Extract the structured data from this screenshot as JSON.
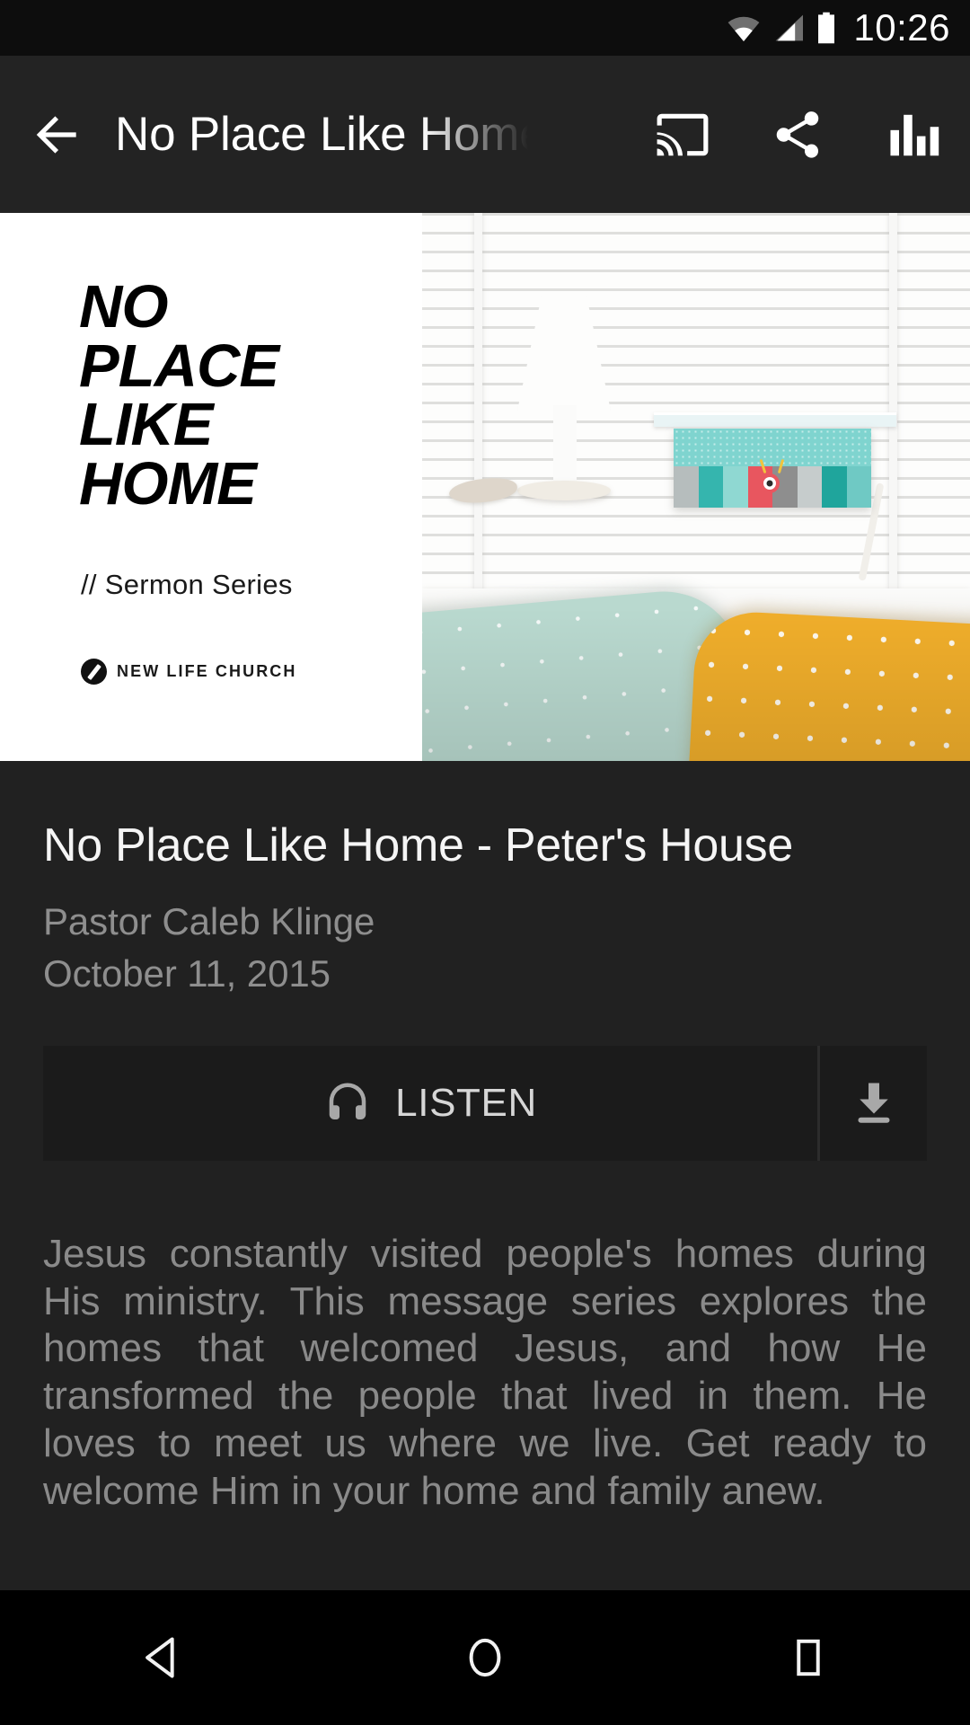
{
  "status_bar": {
    "time": "10:26",
    "icons": [
      "wifi-icon",
      "cellular-signal-icon",
      "battery-icon"
    ]
  },
  "app_bar": {
    "back_icon": "arrow-back-icon",
    "title": "No Place Like Home",
    "actions": [
      {
        "name": "cast-icon",
        "label": "Cast"
      },
      {
        "name": "share-icon",
        "label": "Share"
      },
      {
        "name": "equalizer-icon",
        "label": "Equalizer"
      }
    ]
  },
  "artwork": {
    "lines": [
      "NO",
      "PLACE",
      "LIKE",
      "HOME"
    ],
    "subtitle": "// Sermon Series",
    "church": "NEW LIFE CHURCH",
    "photo_alt": "Bedroom window with lamp, teal storage box and pillows",
    "colors": {
      "lid": "#7fd4cf",
      "pillow_mint": "#b9d9cf",
      "pillow_yellow": "#f0ae2b",
      "monster_red": "#e8565f"
    },
    "box_stripes": [
      "#b6bdbd",
      "#35b5ae",
      "#8fd8d2",
      "#e8565f",
      "#8e8e8e",
      "#c6cccc",
      "#1fa59c",
      "#6fc9c4"
    ]
  },
  "details": {
    "title": "No Place Like Home - Peter's House",
    "speaker": "Pastor Caleb Klinge",
    "date": "October 11, 2015"
  },
  "actions": {
    "listen_label": "LISTEN",
    "listen_icon": "headphones-icon",
    "download_icon": "download-icon"
  },
  "description": "Jesus constantly visited people's homes during His ministry. This message series explores the homes that welcomed Jesus, and how He transformed the people that lived in them. He loves to meet us where we live. Get ready to welcome Him in your home and family anew.",
  "nav_bar": {
    "back": "nav-back-icon",
    "home": "nav-home-icon",
    "recents": "nav-recents-icon"
  }
}
